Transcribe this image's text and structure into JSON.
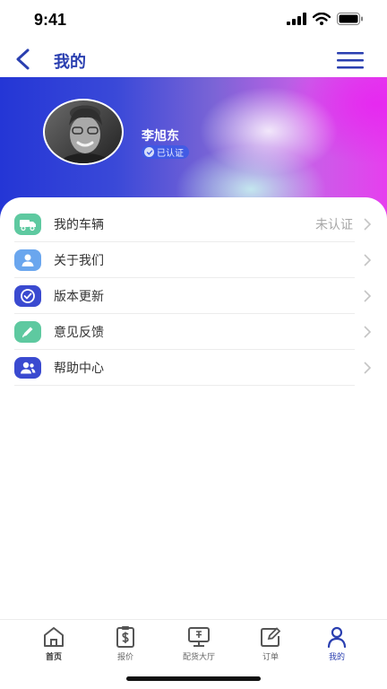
{
  "status_bar": {
    "time": "9:41"
  },
  "nav": {
    "title": "我的"
  },
  "profile": {
    "name": "李旭东",
    "badge": "已认证"
  },
  "menu": {
    "items": [
      {
        "label": "我的车辆",
        "value": "未认证",
        "icon": "truck-icon",
        "color": "#5ec9a0"
      },
      {
        "label": "关于我们",
        "value": "",
        "icon": "person-icon",
        "color": "#6aa6ee"
      },
      {
        "label": "版本更新",
        "value": "",
        "icon": "check-badge-icon",
        "color": "#3a4ad0"
      },
      {
        "label": "意见反馈",
        "value": "",
        "icon": "pencil-icon",
        "color": "#5ec9a0"
      },
      {
        "label": "帮助中心",
        "value": "",
        "icon": "people-icon",
        "color": "#3a4ad0"
      }
    ]
  },
  "tabs": [
    {
      "label": "首页",
      "icon": "home-icon"
    },
    {
      "label": "报价",
      "icon": "clipboard-dollar-icon"
    },
    {
      "label": "配货大厅",
      "icon": "monitor-icon"
    },
    {
      "label": "订单",
      "icon": "edit-icon"
    },
    {
      "label": "我的",
      "icon": "user-icon"
    }
  ],
  "colors": {
    "brand": "#2a3fb0",
    "accent_green": "#5ec9a0"
  }
}
